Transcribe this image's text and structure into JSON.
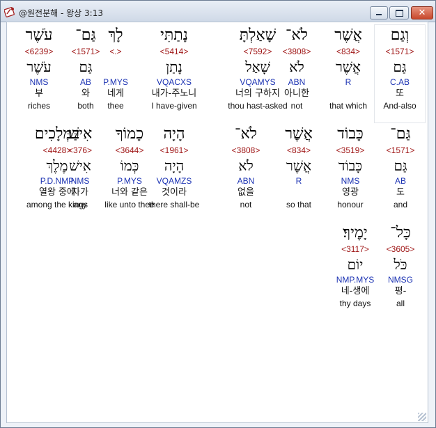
{
  "window": {
    "title": "@원전분해 - 왕상 3:13",
    "app_icon": "bible-app-icon",
    "controls": {
      "minimize": "minimize-icon",
      "maximize": "maximize-icon",
      "close": "✕"
    }
  },
  "rows": [
    [
      {
        "heb": "וְגַם",
        "strong": "<1571>",
        "lemma": "גַּם",
        "morph": "C.AB",
        "kor": "또",
        "eng": "And-also",
        "selected": true
      },
      {
        "heb": "אֲשֶׁר",
        "strong": "<834>",
        "lemma": "אֲשֶׁר",
        "morph": "R",
        "kor": "",
        "eng": "that which"
      },
      {
        "heb": "לֹא־",
        "strong": "<3808>",
        "lemma": "לֹא",
        "morph": "ABN",
        "kor": "아니한",
        "eng": "not"
      },
      {
        "heb": "שָׁאַלְתָּ",
        "strong": "<7592>",
        "lemma": "שָׁאַל",
        "morph": "VQAMYS",
        "kor": "너의 구하지",
        "eng": "thou hast-asked"
      },
      {
        "heb": "נָתַתִּי",
        "strong": "<5414>",
        "lemma": "נָתַן",
        "morph": "VQACXS",
        "kor": "내가-주노니",
        "eng": "I have-given"
      },
      {
        "heb": "לָךְ",
        "strong": "<.>",
        "lemma": "",
        "morph": "P.MYS",
        "kor": "네게",
        "eng": "thee"
      },
      {
        "heb": "גַּם־",
        "strong": "<1571>",
        "lemma": "גַּם",
        "morph": "AB",
        "kor": "와",
        "eng": "both"
      },
      {
        "heb": "עֹשֶׁר",
        "strong": "<6239>",
        "lemma": "עֹשֶׁר",
        "morph": "NMS",
        "kor": "부",
        "eng": "riches"
      }
    ],
    [
      {
        "heb": "גַּם־",
        "strong": "<1571>",
        "lemma": "גַּם",
        "morph": "AB",
        "kor": "도",
        "eng": "and"
      },
      {
        "heb": "כָּבוֹד",
        "strong": "<3519>",
        "lemma": "כָּבוֹד",
        "morph": "NMS",
        "kor": "영광",
        "eng": "honour"
      },
      {
        "heb": "אֲשֶׁר",
        "strong": "<834>",
        "lemma": "אֲשֶׁר",
        "morph": "R",
        "kor": "",
        "eng": "so that"
      },
      {
        "heb": "לֹא־",
        "strong": "<3808>",
        "lemma": "לֹא",
        "morph": "ABN",
        "kor": "없을",
        "eng": "not"
      },
      {
        "heb": "הָיָה",
        "strong": "<1961>",
        "lemma": "הָיָה",
        "morph": "VQAMZS",
        "kor": "것이라",
        "eng": "there shall-be"
      },
      {
        "heb": "כָמוֹךָ",
        "strong": "<3644>",
        "lemma": "כְּמוֹ",
        "morph": "P.MYS",
        "kor": "너와 같은",
        "eng": "like unto thee"
      },
      {
        "heb": "אִישׁ",
        "strong": "<376>",
        "lemma": "אִישׁ",
        "morph": "NMS",
        "kor": "자가",
        "eng": "any"
      },
      {
        "heb": "בַּמְּלָכִים",
        "strong": "<4428>",
        "lemma": "מֶלֶךְ",
        "morph": "P.D.NMP",
        "kor": "열왕 중에",
        "eng": "among the kings"
      }
    ],
    [
      {
        "heb": "כָּל־",
        "strong": "<3605>",
        "lemma": "כֹּל",
        "morph": "NMSG",
        "kor": "평-",
        "eng": "all"
      },
      {
        "heb": "יָמֶיךָ׃",
        "strong": "<3117>",
        "lemma": "יוֹם",
        "morph": "NMP.MYS",
        "kor": "네-생에",
        "eng": "thy days"
      }
    ]
  ]
}
